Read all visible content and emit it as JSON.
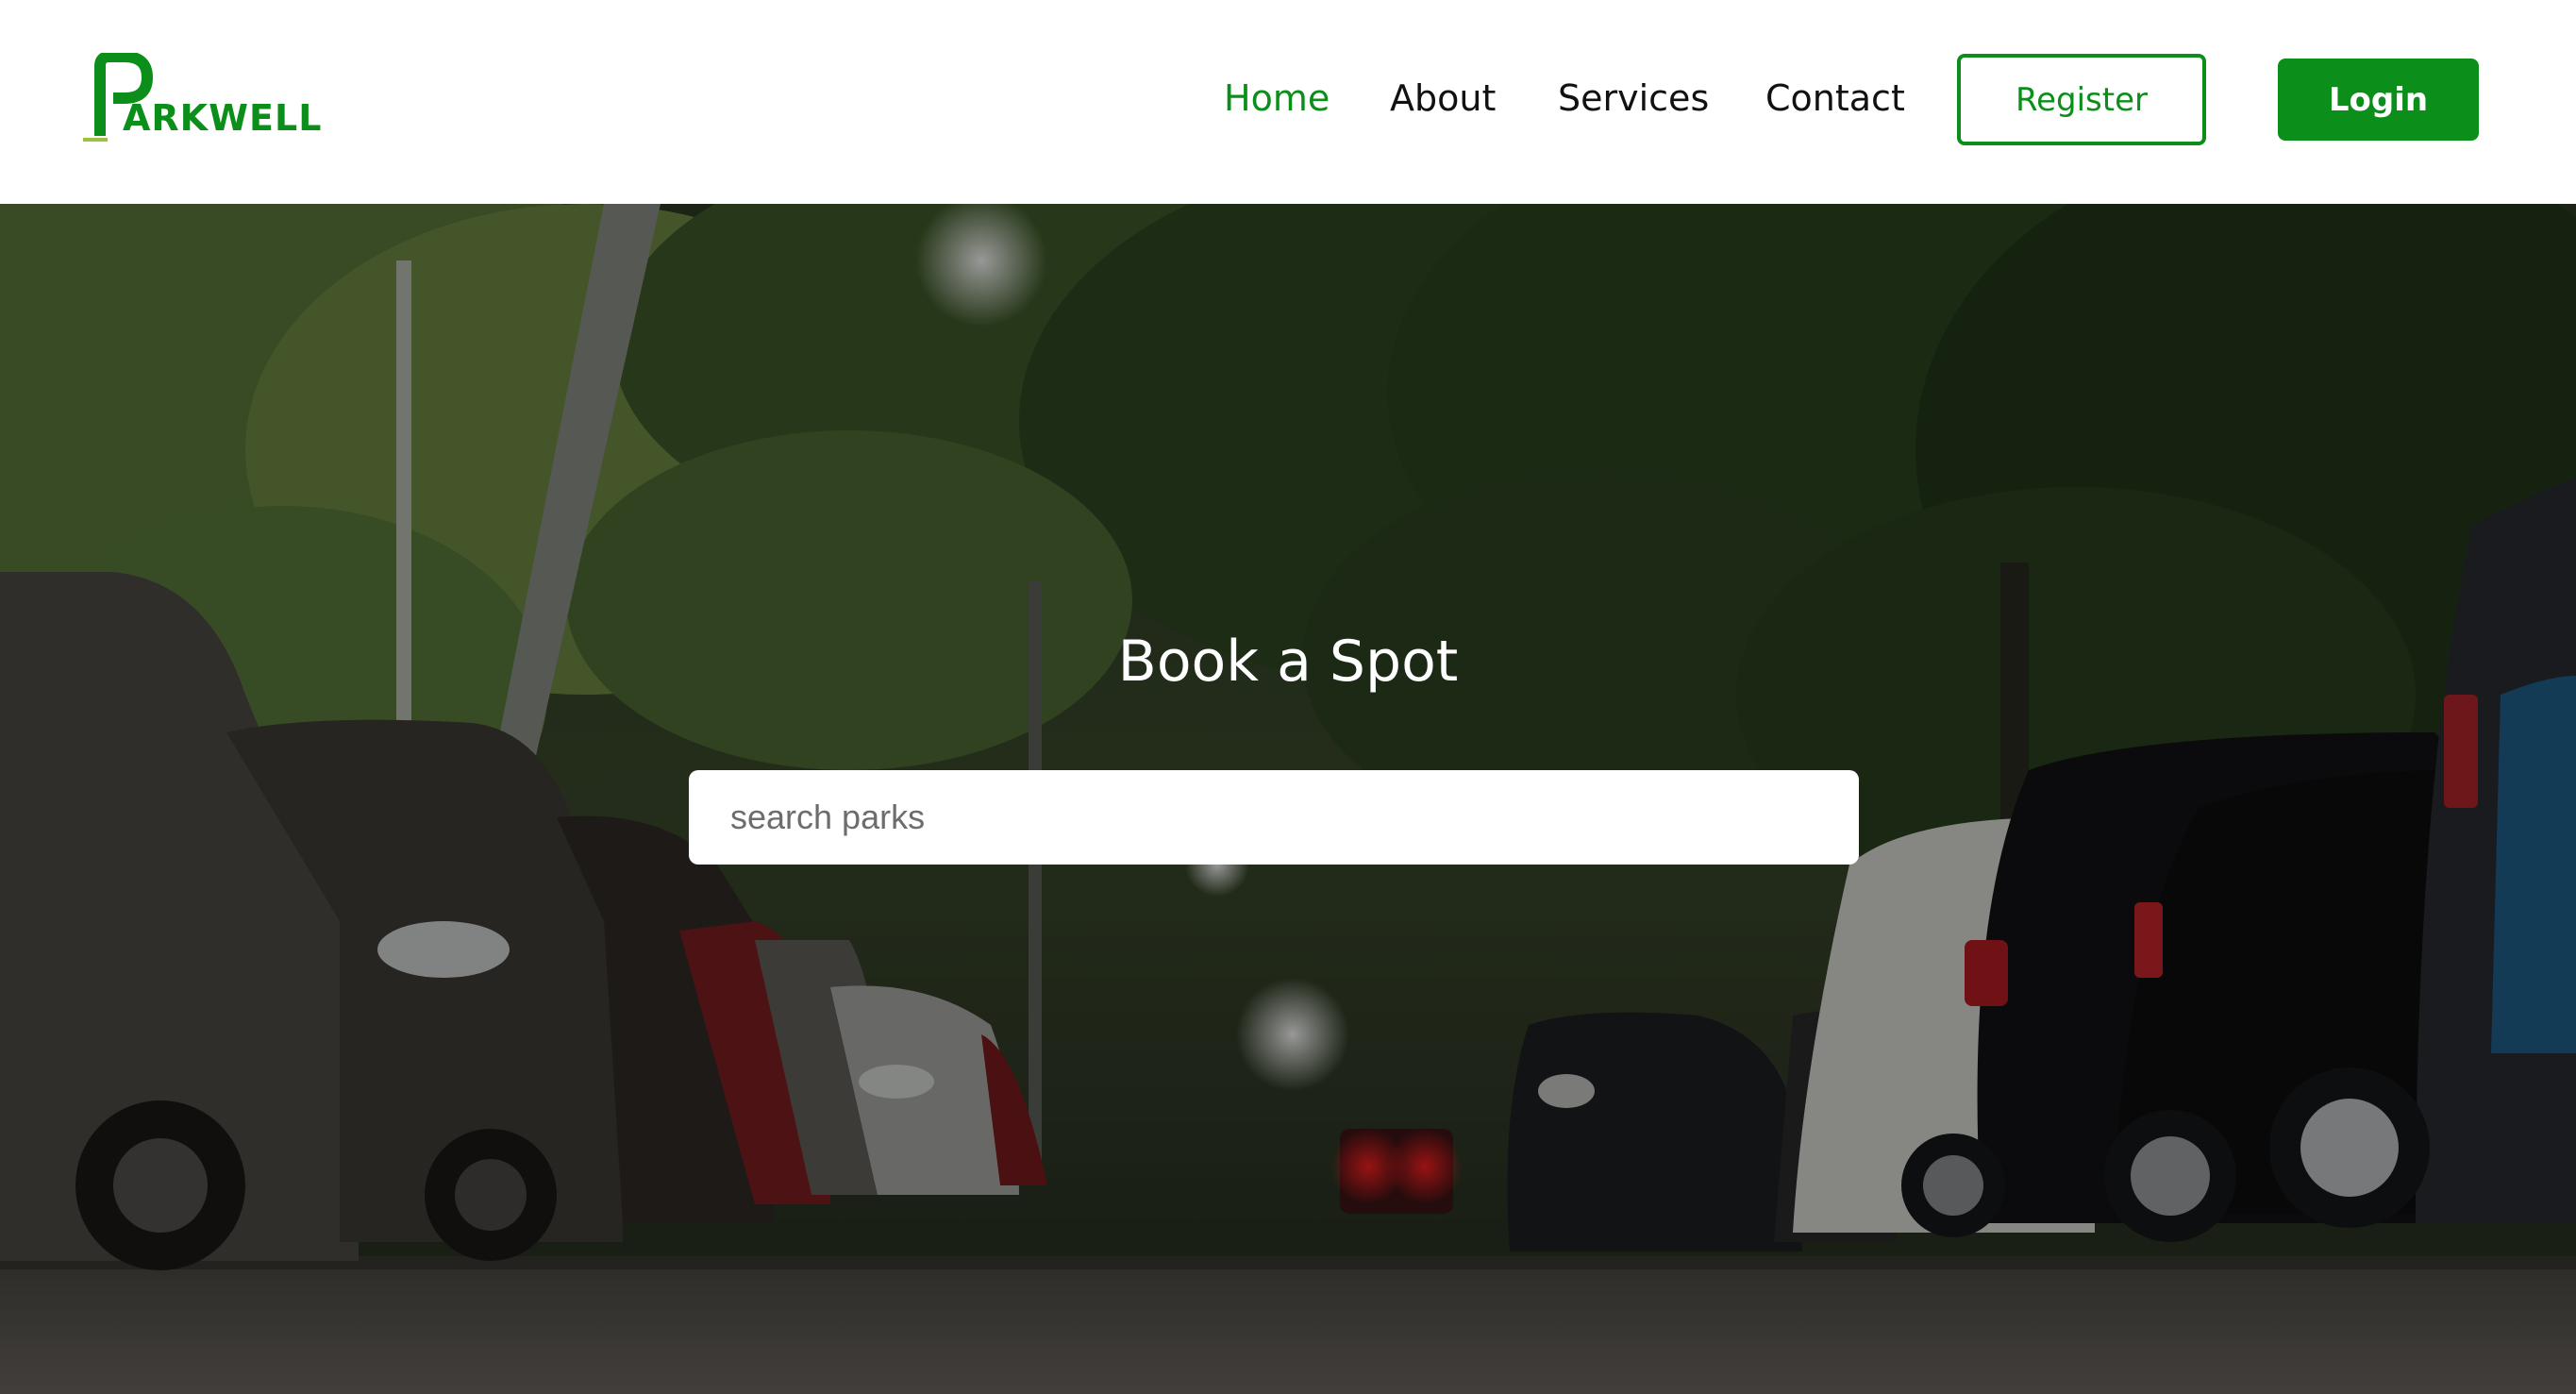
{
  "brand": {
    "name": "ARKWELL",
    "accent_color": "#0c8f1a",
    "icon": "parking-pin-icon"
  },
  "nav": {
    "items": [
      {
        "label": "Home",
        "active": true
      },
      {
        "label": "About",
        "active": false
      },
      {
        "label": "Services",
        "active": false
      },
      {
        "label": "Contact",
        "active": false
      }
    ]
  },
  "auth": {
    "register_label": "Register",
    "login_label": "Login"
  },
  "hero": {
    "title": "Book a Spot",
    "background": "tree-lined-street-with-parked-cars-photo",
    "search": {
      "placeholder": "search parks",
      "value": ""
    }
  }
}
